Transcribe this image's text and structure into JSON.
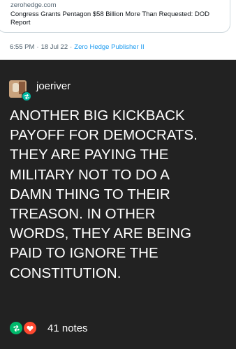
{
  "tweet": {
    "domain": "zerohedge.com",
    "title": "Congress Grants Pentagon $58 Billion More Than Requested: DOD Report",
    "time": "6:55 PM",
    "separator": "·",
    "date": "18 Jul 22",
    "source": "Zero Hedge Publisher II"
  },
  "post": {
    "username": "joeriver",
    "body_lines": [
      "ANOTHER BIG KICKBACK",
      "PAYOFF FOR DEMOCRATS.",
      "THEY ARE PAYING THE",
      "MILITARY NOT TO DO A",
      "DAMN THING TO THEIR",
      "TREASON. IN OTHER",
      "WORDS, THEY ARE BEING",
      "PAID TO IGNORE THE",
      "CONSTITUTION."
    ],
    "notes": "41 notes"
  },
  "icons": {
    "avatar": "user-avatar",
    "reblog_badge": "reblog-icon",
    "footer_reblog": "reblog-icon",
    "footer_like": "heart-icon"
  },
  "colors": {
    "background": "#222222",
    "text": "#ffffff",
    "link": "#1d9bf0",
    "reblog": "#00b86b",
    "like": "#ff4930"
  }
}
